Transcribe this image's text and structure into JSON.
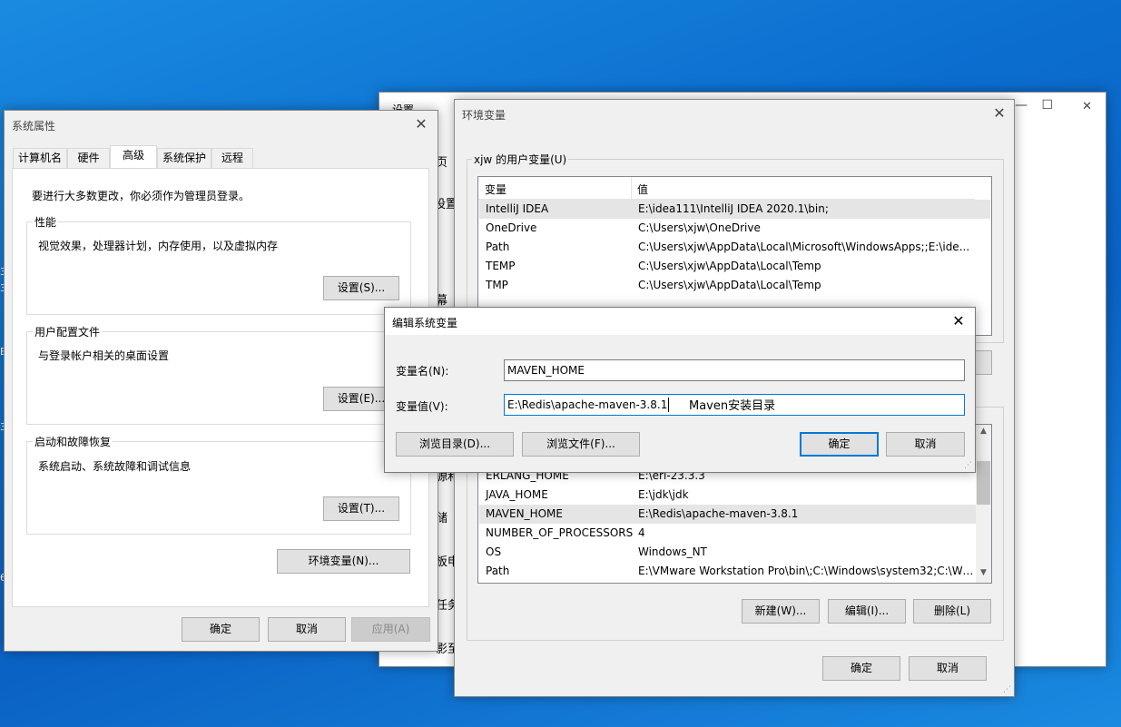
{
  "desktop": {
    "edge_glyphs": [
      "3",
      "3",
      "E",
      "3",
      "6"
    ]
  },
  "settings_window": {
    "title": "设置",
    "side_fragments": [
      "页",
      "设置",
      "幕",
      "源和",
      "储",
      "板申",
      "任务",
      "影至"
    ],
    "minimize": "—",
    "maximize": "☐",
    "close": "✕"
  },
  "system_properties": {
    "title": "系统属性",
    "tabs": [
      "计算机名",
      "硬件",
      "高级",
      "系统保护",
      "远程"
    ],
    "active_tab": "高级",
    "admin_notice": "要进行大多数更改，你必须作为管理员登录。",
    "performance": {
      "label": "性能",
      "description": "视觉效果，处理器计划，内存使用，以及虚拟内存",
      "button": "设置(S)..."
    },
    "user_profiles": {
      "label": "用户配置文件",
      "description": "与登录帐户相关的桌面设置",
      "button": "设置(E)..."
    },
    "startup_recovery": {
      "label": "启动和故障恢复",
      "description": "系统启动、系统故障和调试信息",
      "button": "设置(T)..."
    },
    "env_button": "环境变量(N)...",
    "ok": "确定",
    "cancel": "取消",
    "apply": "应用(A)"
  },
  "env_vars": {
    "title": "环境变量",
    "user_group_label": "xjw 的用户变量(U)",
    "col_variable": "变量",
    "col_value": "值",
    "user_vars": [
      {
        "name": "IntelliJ IDEA",
        "value": "E:\\idea111\\IntelliJ IDEA 2020.1\\bin;"
      },
      {
        "name": "OneDrive",
        "value": "C:\\Users\\xjw\\OneDrive"
      },
      {
        "name": "Path",
        "value": "C:\\Users\\xjw\\AppData\\Local\\Microsoft\\WindowsApps;;E:\\ide..."
      },
      {
        "name": "TEMP",
        "value": "C:\\Users\\xjw\\AppData\\Local\\Temp"
      },
      {
        "name": "TMP",
        "value": "C:\\Users\\xjw\\AppData\\Local\\Temp"
      }
    ],
    "system_vars": [
      {
        "name": "ERLANG_HOME",
        "value": "E:\\erl-23.3.3"
      },
      {
        "name": "JAVA_HOME",
        "value": "E:\\jdk\\jdk"
      },
      {
        "name": "MAVEN_HOME",
        "value": "E:\\Redis\\apache-maven-3.8.1"
      },
      {
        "name": "NUMBER_OF_PROCESSORS",
        "value": "4"
      },
      {
        "name": "OS",
        "value": "Windows_NT"
      },
      {
        "name": "Path",
        "value": "E:\\VMware Workstation Pro\\bin\\;C:\\Windows\\system32;C:\\Wi..."
      }
    ],
    "new_button": "新建(W)...",
    "edit_button": "编辑(I)...",
    "delete_button": "删除(L)",
    "ok": "确定",
    "cancel": "取消",
    "scroll_up": "▲",
    "scroll_down": "▼"
  },
  "edit_dialog": {
    "title": "编辑系统变量",
    "name_label": "变量名(N):",
    "name_value": "MAVEN_HOME",
    "value_label": "变量值(V):",
    "value_value": "E:\\Redis\\apache-maven-3.8.1",
    "annotation": "Maven安装目录",
    "browse_dir": "浏览目录(D)...",
    "browse_file": "浏览文件(F)...",
    "ok": "确定",
    "cancel": "取消"
  }
}
